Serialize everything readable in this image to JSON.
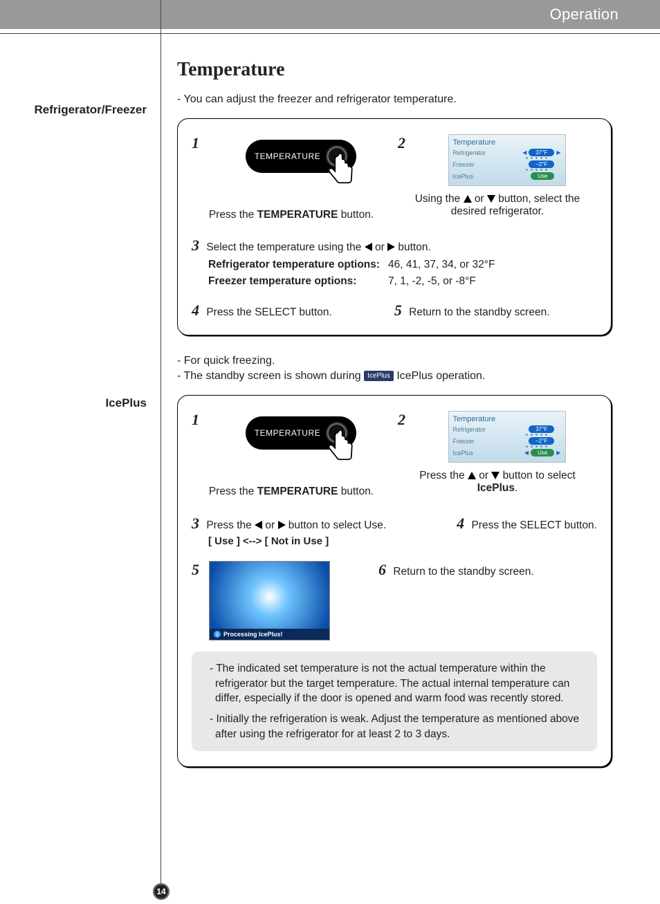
{
  "header": "Operation",
  "page_number": "14",
  "title": "Temperature",
  "section1": {
    "side_label": "Refrigerator/Freezer",
    "intro": "- You can adjust the freezer and refrigerator temperature.",
    "step1_num": "1",
    "btn_label": "TEMPERATURE",
    "step1_cap_a": "Press the ",
    "step1_cap_b": "TEMPERATURE",
    "step1_cap_c": " button.",
    "step2_num": "2",
    "lcd": {
      "title": "Temperature",
      "row1_label": "Refrigerator",
      "row1_val": "37°F",
      "row2_label": "Freezer",
      "row2_val": "−2°F",
      "row3_label": "IcePlus",
      "row3_val": "Use"
    },
    "step2_cap_a": "Using the ",
    "step2_cap_b": " or ",
    "step2_cap_c": " button, select the desired refrigerator.",
    "step3_num": "3",
    "step3_a": "Select the temperature using the ",
    "step3_b": " or ",
    "step3_c": " button.",
    "opt1_label": "Refrigerator temperature options:",
    "opt1_val": "46, 41, 37, 34, or 32°F",
    "opt2_label": "Freezer temperature options:",
    "opt2_val": "7, 1, -2, -5, or -8°F",
    "step4_num": "4",
    "step4_a": "Press the ",
    "step4_b": "SELECT",
    "step4_c": " button.",
    "step5_num": "5",
    "step5": "Return to the standby screen."
  },
  "section2": {
    "side_label": "IcePlus",
    "intro1": "- For quick freezing.",
    "intro2a": "- The standby screen is shown during ",
    "intro2_badge": "IcePlus",
    "intro2b": " IcePlus operation.",
    "step1_num": "1",
    "step1_cap_a": "Press the ",
    "step1_cap_b": "TEMPERATURE",
    "step1_cap_c": " button.",
    "step2_num": "2",
    "step2_cap_a": "Press the ",
    "step2_cap_b": " or ",
    "step2_cap_c": " button to select ",
    "step2_cap_d": "IcePlus",
    "step2_cap_e": ".",
    "step3_num": "3",
    "step3_a": "Press the ",
    "step3_b": " or ",
    "step3_c": " button to select ",
    "step3_d": "Use",
    "step3_e": ".",
    "toggle": "[ Use ] <--> [ Not in Use ]",
    "step4_num": "4",
    "step4_a": "Press the ",
    "step4_b": "SELECT",
    "step4_c": " button.",
    "step5_num": "5",
    "proc_text": "Processing IcePlus!",
    "step6_num": "6",
    "step6": "Return to the standby screen.",
    "note1": "- The indicated set temperature is not the actual temperature within the refrigerator but the target temperature. The actual internal temperature can differ, especially if the door is opened and warm food was recently stored.",
    "note2": "- Initially the refrigeration is weak. Adjust the temperature as mentioned above after using the refrigerator for at least 2 to 3 days."
  }
}
